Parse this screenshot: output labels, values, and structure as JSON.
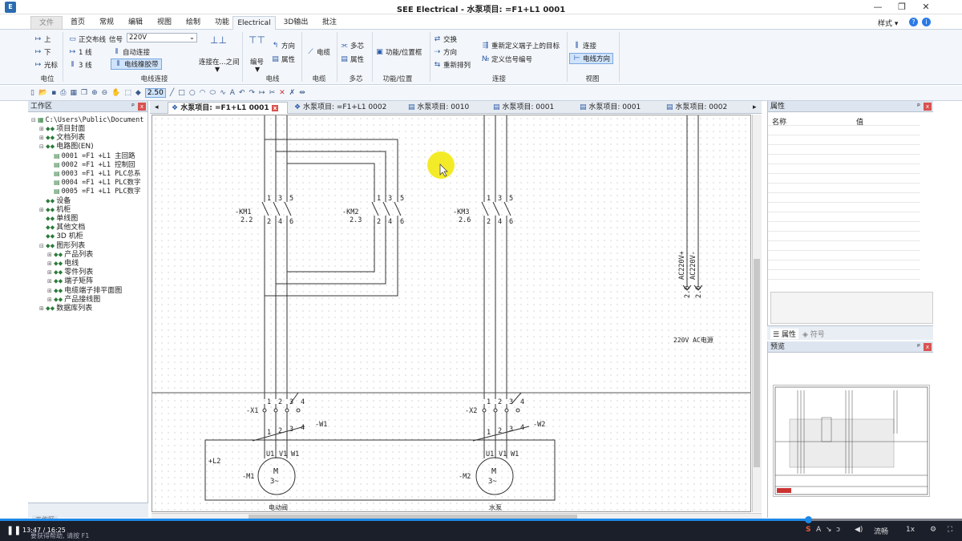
{
  "window": {
    "title": "SEE Electrical - 水泵项目: =F1+L1 0001",
    "minimize": "—",
    "restore": "❐",
    "close": "✕"
  },
  "ribbon_tabs": [
    "文件",
    "首页",
    "常规",
    "编辑",
    "视图",
    "绘制",
    "功能",
    "Electrical",
    "3D输出",
    "批注"
  ],
  "style_label": "样式",
  "ribbon": {
    "potential": {
      "up": "上",
      "down": "下",
      "cursor": "光标",
      "group": "电位"
    },
    "wires": {
      "free_wire": "正交布线",
      "signal_label": "信号",
      "signal_value": "220V",
      "one_line": "1 线",
      "three_line": "3 线",
      "auto_connect": "自动连接",
      "rubber_band": "电线橡胶带",
      "between": "连接在...之间",
      "group": "电线连接"
    },
    "wire": {
      "numbering": "编号",
      "direction": "方向",
      "attribute": "属性",
      "group": "电线"
    },
    "cable": {
      "cable": "电缆",
      "group": "电缆"
    },
    "multicore": {
      "multicore": "多芯",
      "attribute": "属性",
      "group": "多芯"
    },
    "function": {
      "frame": "功能/位置框",
      "group": "功能/位置"
    },
    "connect": {
      "swap": "交换",
      "direction": "方向",
      "reorder": "重新排列",
      "redefine": "重新定义端子上的目标",
      "signal_number": "定义信号编号",
      "group": "连接"
    },
    "view": {
      "connect": "连接",
      "wire_direction": "电线方向",
      "group": "视图"
    }
  },
  "toolbar": {
    "zoom_value": "2.50"
  },
  "workspace": {
    "title": "工作区",
    "pin": "ᵖ",
    "close": "x",
    "root": "C:\\Users\\Public\\Document",
    "items": [
      {
        "label": "项目封面"
      },
      {
        "label": "文档列表"
      },
      {
        "label": "电路图(EN)"
      },
      {
        "label": "0001 =F1 +L1 主回路"
      },
      {
        "label": "0002 =F1 +L1 控制回"
      },
      {
        "label": "0003 =F1 +L1 PLC总系"
      },
      {
        "label": "0004 =F1 +L1 PLC数字"
      },
      {
        "label": "0005 =F1 +L1 PLC数字"
      },
      {
        "label": "设备"
      },
      {
        "label": "机柜"
      },
      {
        "label": "单线图"
      },
      {
        "label": "其他文档"
      },
      {
        "label": "3D 机柜"
      },
      {
        "label": "图形列表"
      },
      {
        "label": "产品列表"
      },
      {
        "label": "电线"
      },
      {
        "label": "零件列表"
      },
      {
        "label": "端子矩阵"
      },
      {
        "label": "电缆端子排平面图"
      },
      {
        "label": "产品接线图"
      },
      {
        "label": "数据库列表"
      }
    ],
    "footer_tab": "工作区"
  },
  "doc_tabs": [
    {
      "label": "水泵项目: =F1+L1 0001"
    },
    {
      "label": "水泵项目: =F1+L1 0002"
    },
    {
      "label": "水泵项目: 0010"
    },
    {
      "label": "水泵项目: 0001"
    },
    {
      "label": "水泵项目: 0001"
    },
    {
      "label": "水泵项目: 0002"
    }
  ],
  "drawing": {
    "km1": {
      "tag": "-KM1",
      "ref": "2.2",
      "top": [
        "1",
        "3",
        "5"
      ],
      "bot": [
        "2",
        "4",
        "6"
      ]
    },
    "km2": {
      "tag": "-KM2",
      "ref": "2.3",
      "top": [
        "1",
        "3",
        "5"
      ],
      "bot": [
        "2",
        "4",
        "6"
      ]
    },
    "km3": {
      "tag": "-KM3",
      "ref": "2.6",
      "top": [
        "1",
        "3",
        "5"
      ],
      "bot": [
        "2",
        "4",
        "6"
      ]
    },
    "ac1": "AC220V+",
    "ac2": "AC220V-",
    "ac_ref1": "2.0",
    "ac_ref2": "2.0",
    "ac_note": "220V AC电源",
    "x1": {
      "tag": "-X1",
      "nums": [
        "1",
        "2",
        "3",
        "4"
      ]
    },
    "x2": {
      "tag": "-X2",
      "nums": [
        "1",
        "2",
        "3",
        "4"
      ]
    },
    "w1": {
      "tag": "-W1",
      "nums": [
        "1",
        "2",
        "3",
        "4"
      ]
    },
    "w2": {
      "tag": "-W2",
      "nums": [
        "1",
        "2",
        "3",
        "4"
      ]
    },
    "l2": "+L2",
    "m1": {
      "tag": "-M1",
      "pins": [
        "U1",
        "V1",
        "W1"
      ],
      "sym": "M",
      "sub": "3~"
    },
    "m2": {
      "tag": "-M2",
      "pins": [
        "U1",
        "V1",
        "W1"
      ],
      "sym": "M",
      "sub": "3~"
    },
    "cap1": "电动阀",
    "cap2": "水泵"
  },
  "properties": {
    "title": "属性",
    "col_name": "名称",
    "col_value": "值",
    "tab_props": "属性",
    "tab_symbols": "符号"
  },
  "preview": {
    "title": "预览"
  },
  "player": {
    "time": "13:47 / 16:25",
    "progress": 0.84,
    "status": "要获得帮助, 请按 F1",
    "quality": "流畅",
    "speed": "1x"
  }
}
